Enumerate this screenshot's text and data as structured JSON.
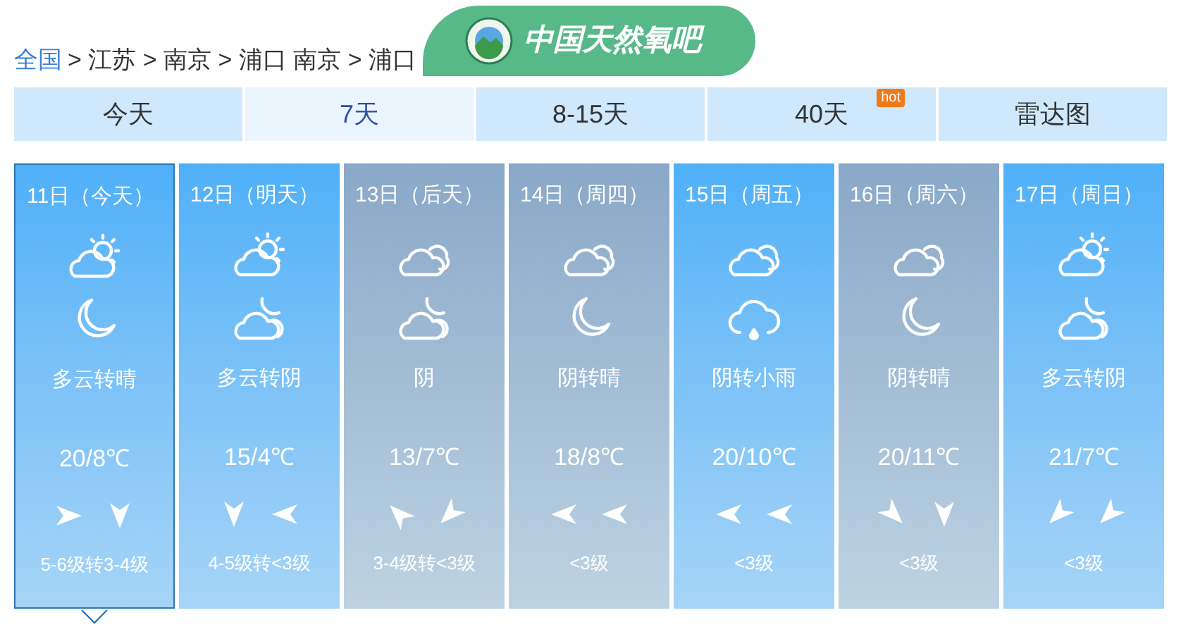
{
  "breadcrumb": {
    "link": "全国",
    "path": "> 江苏 > 南京 > 浦口 南京 > 浦口"
  },
  "logo": {
    "text": "中国天然氧吧"
  },
  "tabs": [
    {
      "label": "今天",
      "selected": false
    },
    {
      "label": "7天",
      "selected": true
    },
    {
      "label": "8-15天",
      "selected": false
    },
    {
      "label": "40天",
      "selected": false,
      "badge": "hot"
    },
    {
      "label": "雷达图",
      "selected": false
    }
  ],
  "days": [
    {
      "date": "11日（今天）",
      "selected": true,
      "kind": "blue",
      "day_icon": {
        "kind": "sun_cloud"
      },
      "night_icon": {
        "kind": "moon"
      },
      "weather": "多云转晴",
      "temp": "20/8℃",
      "wind": [
        {
          "kind": "right"
        },
        {
          "kind": "down"
        }
      ],
      "wind_level": "5-6级转3-4级"
    },
    {
      "date": "12日（明天）",
      "selected": false,
      "kind": "blue",
      "day_icon": {
        "kind": "sun_cloud"
      },
      "night_icon": {
        "kind": "moon_cloud"
      },
      "weather": "多云转阴",
      "temp": "15/4℃",
      "wind": [
        {
          "kind": "down"
        },
        {
          "kind": "left"
        }
      ],
      "wind_level": "4-5级转<3级"
    },
    {
      "date": "13日（后天）",
      "selected": false,
      "kind": "grey",
      "day_icon": {
        "kind": "clouds"
      },
      "night_icon": {
        "kind": "moon_cloud"
      },
      "weather": "阴",
      "temp": "13/7℃",
      "wind": [
        {
          "kind": "upleft"
        },
        {
          "kind": "downleft"
        }
      ],
      "wind_level": "3-4级转<3级"
    },
    {
      "date": "14日（周四）",
      "selected": false,
      "kind": "grey",
      "day_icon": {
        "kind": "clouds"
      },
      "night_icon": {
        "kind": "moon"
      },
      "weather": "阴转晴",
      "temp": "18/8℃",
      "wind": [
        {
          "kind": "left"
        },
        {
          "kind": "left"
        }
      ],
      "wind_level": "<3级"
    },
    {
      "date": "15日（周五）",
      "selected": false,
      "kind": "blue",
      "day_icon": {
        "kind": "clouds"
      },
      "night_icon": {
        "kind": "rain"
      },
      "weather": "阴转小雨",
      "temp": "20/10℃",
      "wind": [
        {
          "kind": "left"
        },
        {
          "kind": "left"
        }
      ],
      "wind_level": "<3级"
    },
    {
      "date": "16日（周六）",
      "selected": false,
      "kind": "grey",
      "day_icon": {
        "kind": "clouds"
      },
      "night_icon": {
        "kind": "moon"
      },
      "weather": "阴转晴",
      "temp": "20/11℃",
      "wind": [
        {
          "kind": "downright"
        },
        {
          "kind": "down"
        }
      ],
      "wind_level": "<3级"
    },
    {
      "date": "17日（周日）",
      "selected": false,
      "kind": "blue",
      "day_icon": {
        "kind": "sun_cloud"
      },
      "night_icon": {
        "kind": "moon_cloud"
      },
      "weather": "多云转阴",
      "temp": "21/7℃",
      "wind": [
        {
          "kind": "downleft"
        },
        {
          "kind": "downleft"
        }
      ],
      "wind_level": "<3级"
    }
  ]
}
